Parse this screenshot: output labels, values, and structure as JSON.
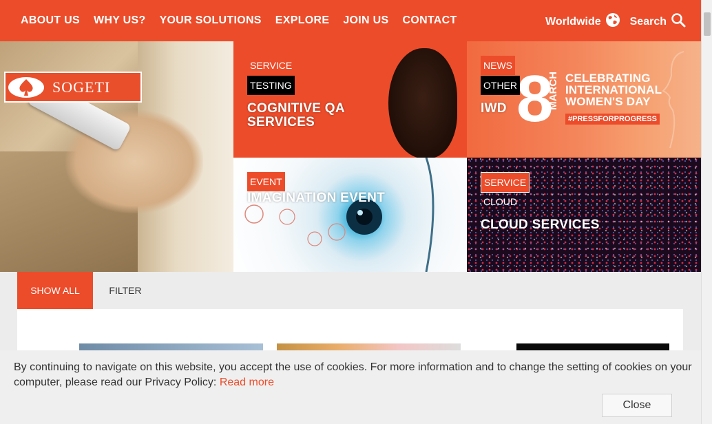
{
  "nav": {
    "items": [
      {
        "label": "ABOUT US"
      },
      {
        "label": "WHY US?"
      },
      {
        "label": "YOUR SOLUTIONS"
      },
      {
        "label": "EXPLORE"
      },
      {
        "label": "JOIN US"
      },
      {
        "label": "CONTACT"
      }
    ],
    "worldwide_label": "Worldwide",
    "search_label": "Search"
  },
  "brand": {
    "logo_text": "SOGETI",
    "accent": "#ec4c2a"
  },
  "tiles": {
    "cognitive": {
      "tag1": "SERVICE",
      "tag2": "TESTING",
      "title_line1": "COGNITIVE QA",
      "title_line2": "SERVICES"
    },
    "iwd": {
      "tag1": "NEWS",
      "tag2": "OTHER",
      "title": "IWD",
      "big_number": "8",
      "month": "MARCH",
      "line1": "CELEBRATING",
      "line2": "INTERNATIONAL",
      "line3": "WOMEN'S DAY",
      "hashtag": "#PRESSFORPROGRESS"
    },
    "imagination": {
      "tag1": "EVENT",
      "title": "IMAGINATION EVENT"
    },
    "cloud": {
      "tag1": "SERVICE",
      "tag2": "CLOUD",
      "title": "CLOUD SERVICES"
    }
  },
  "filterbar": {
    "show_all": "SHOW ALL",
    "filter": "FILTER"
  },
  "cookie": {
    "text": "By continuing to navigate on this website, you accept the use of cookies. For more information and to change the setting of cookies on your computer, please read our Privacy Policy: ",
    "link": "Read more",
    "close": "Close"
  }
}
